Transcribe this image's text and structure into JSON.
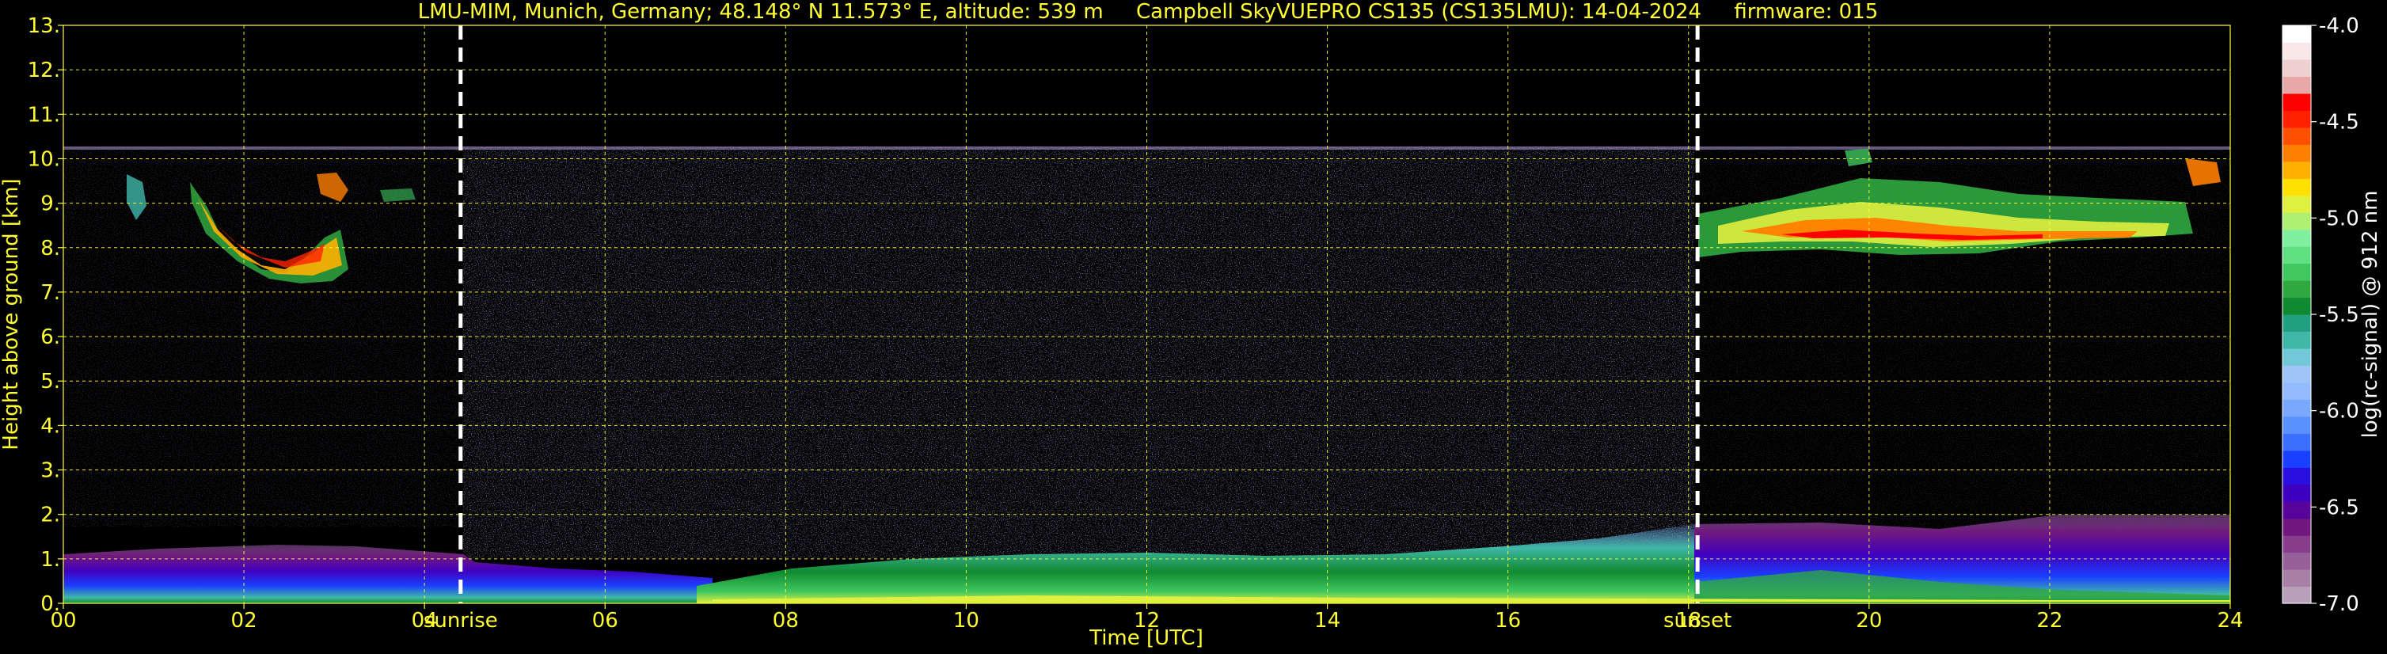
{
  "chart_data": {
    "type": "heatmap",
    "title": "LMU-MIM, Munich, Germany; 48.148° N 11.573° E, altitude: 539 m     Campbell SkyVUEPRO CS135 (CS135LMU): 14-04-2024     firmware: 015",
    "xlabel": "Time [UTC]",
    "ylabel": "Height above ground [km]",
    "xlim": [
      0,
      24
    ],
    "ylim": [
      0,
      13
    ],
    "x_ticks": [
      "00",
      "02",
      "04",
      "06",
      "08",
      "10",
      "12",
      "14",
      "16",
      "18",
      "20",
      "22",
      "24"
    ],
    "y_ticks": [
      "0.",
      "1.",
      "2.",
      "3.",
      "4.",
      "5.",
      "6.",
      "7.",
      "8.",
      "9.",
      "10.",
      "11.",
      "12.",
      "13."
    ],
    "grid": true,
    "colorbar": {
      "label": "log(rc-signal) @ 912 nm",
      "range": [
        -7.0,
        -4.0
      ],
      "ticks": [
        "-4.0",
        "-4.5",
        "-5.0",
        "-5.5",
        "-6.0",
        "-6.5",
        "-7.0"
      ],
      "tick_values": [
        -4.0,
        -4.5,
        -5.0,
        -5.5,
        -6.0,
        -6.5,
        -7.0
      ],
      "colors": [
        "#b8a0b8",
        "#a880a8",
        "#98609a",
        "#883c8c",
        "#70187e",
        "#58049a",
        "#4000c0",
        "#2a10e0",
        "#1a40ff",
        "#3a70ff",
        "#5a90ff",
        "#7aa8ff",
        "#94baff",
        "#a0c4f8",
        "#70c8d8",
        "#40b8a8",
        "#20a080",
        "#108a30",
        "#30a840",
        "#40c860",
        "#60e080",
        "#80f0a0",
        "#b0f070",
        "#e0f040",
        "#ffe000",
        "#ffb000",
        "#ff8000",
        "#ff5000",
        "#ff2000",
        "#ff0000",
        "#e8a8a8",
        "#f0d0d0",
        "#f8e8e8",
        "#ffffff"
      ]
    },
    "annotations": [
      {
        "text": "sunrise",
        "x": 4.4
      },
      {
        "text": "sunset",
        "x": 18.1
      }
    ],
    "features": [
      {
        "name": "boundary-layer",
        "x_range": [
          0,
          24
        ],
        "height_km": [
          0,
          1.8
        ]
      },
      {
        "name": "cirrus-morning",
        "x_range": [
          0.6,
          3.3
        ],
        "height_km": [
          7.3,
          9.6
        ]
      },
      {
        "name": "cirrus-evening",
        "x_range": [
          18.1,
          23.8
        ],
        "height_km": [
          7.6,
          10.2
        ]
      },
      {
        "name": "noise-ceiling",
        "height_km": 10.2
      }
    ]
  }
}
